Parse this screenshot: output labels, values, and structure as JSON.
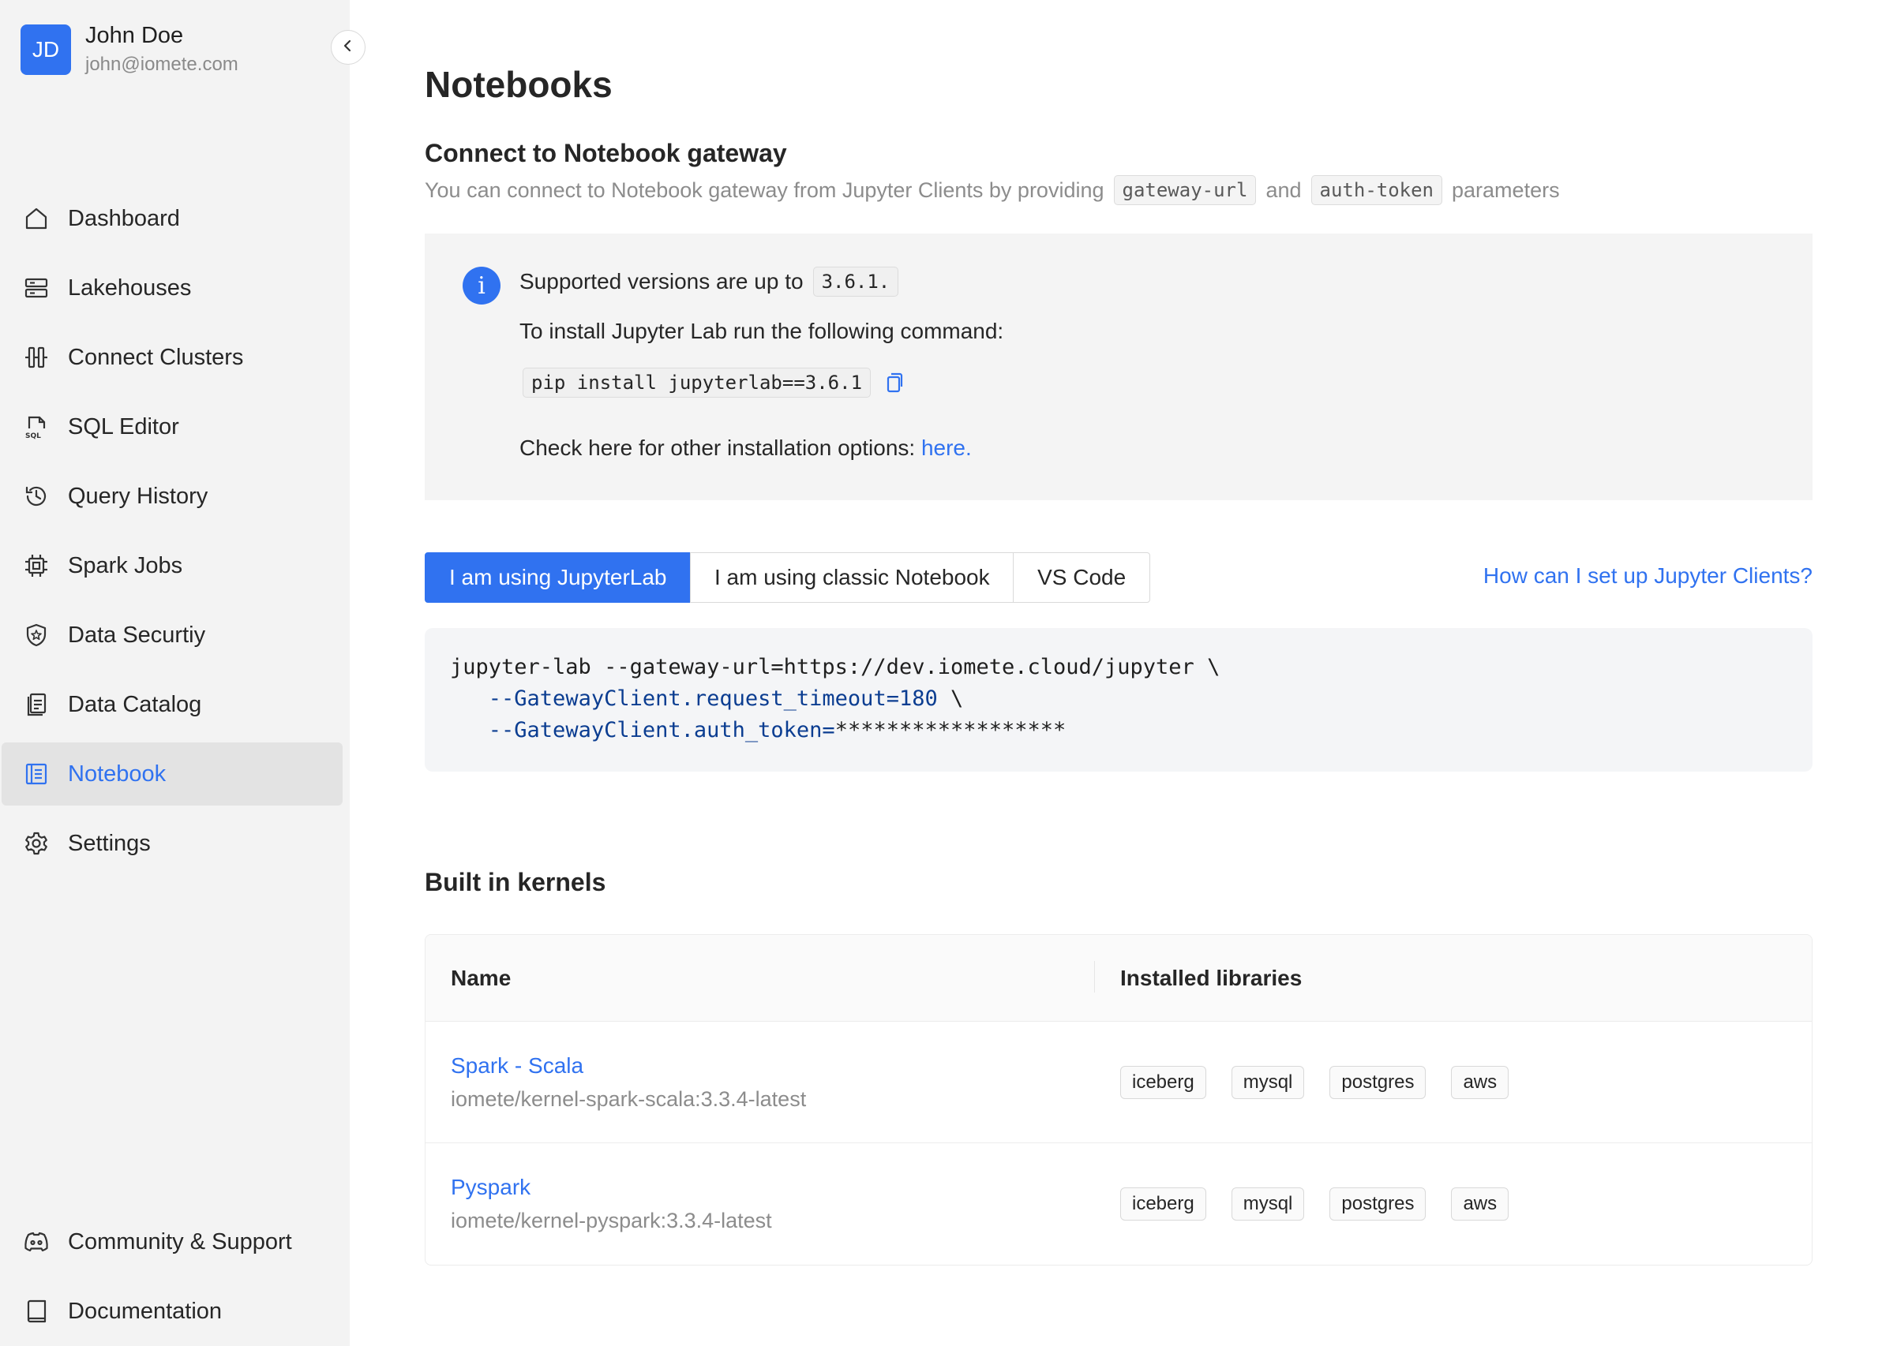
{
  "user": {
    "initials": "JD",
    "name": "John Doe",
    "email": "john@iomete.com"
  },
  "sidebar": {
    "items": [
      {
        "label": "Dashboard",
        "icon": "home-icon"
      },
      {
        "label": "Lakehouses",
        "icon": "server-icon"
      },
      {
        "label": "Connect Clusters",
        "icon": "connect-clusters-icon"
      },
      {
        "label": "SQL Editor",
        "icon": "sql-file-icon"
      },
      {
        "label": "Query History",
        "icon": "history-icon"
      },
      {
        "label": "Spark Jobs",
        "icon": "cpu-chip-icon"
      },
      {
        "label": "Data Securtiy",
        "icon": "shield-icon"
      },
      {
        "label": "Data Catalog",
        "icon": "catalog-icon"
      },
      {
        "label": "Notebook",
        "icon": "notebook-icon",
        "active": true
      },
      {
        "label": "Settings",
        "icon": "gear-icon"
      }
    ],
    "bottom_items": [
      {
        "label": "Community & Support",
        "icon": "discord-icon"
      },
      {
        "label": "Documentation",
        "icon": "book-icon"
      }
    ]
  },
  "page": {
    "title": "Notebooks",
    "connect_title": "Connect to Notebook gateway",
    "connect_desc_prefix": "You can connect to Notebook gateway from Jupyter Clients by providing",
    "param1": "gateway-url",
    "connect_desc_and": "and",
    "param2": "auth-token",
    "connect_desc_suffix": "parameters"
  },
  "info": {
    "versions_text": "Supported versions are up to",
    "version": "3.6.1.",
    "install_text": "To install Jupyter Lab run the following command:",
    "install_cmd": "pip install jupyterlab==3.6.1",
    "options_text": "Check here for other installation options:",
    "options_link": "here."
  },
  "tabs": [
    {
      "label": "I am using JupyterLab",
      "active": true
    },
    {
      "label": "I am using classic Notebook",
      "active": false
    },
    {
      "label": "VS Code",
      "active": false
    }
  ],
  "help_link": "How can I set up Jupyter Clients?",
  "code": {
    "line1": "jupyter-lab --gateway-url=https://dev.iomete.cloud/jupyter \\",
    "line2_blue": "--GatewayClient.request_timeout=180",
    "line2_rest": " \\",
    "line3_blue": "--GatewayClient.auth_token=",
    "line3_rest": "******************"
  },
  "kernels": {
    "title": "Built in kernels",
    "columns": [
      "Name",
      "Installed libraries"
    ],
    "rows": [
      {
        "name": "Spark - Scala",
        "image": "iomete/kernel-spark-scala:3.3.4-latest",
        "libraries": [
          "iceberg",
          "mysql",
          "postgres",
          "aws"
        ]
      },
      {
        "name": "Pyspark",
        "image": "iomete/kernel-pyspark:3.3.4-latest",
        "libraries": [
          "iceberg",
          "mysql",
          "postgres",
          "aws"
        ]
      }
    ]
  },
  "colors": {
    "accent": "#3072f0",
    "sidebar_bg": "#f3f3f3",
    "muted_text": "#8c8c8c"
  }
}
